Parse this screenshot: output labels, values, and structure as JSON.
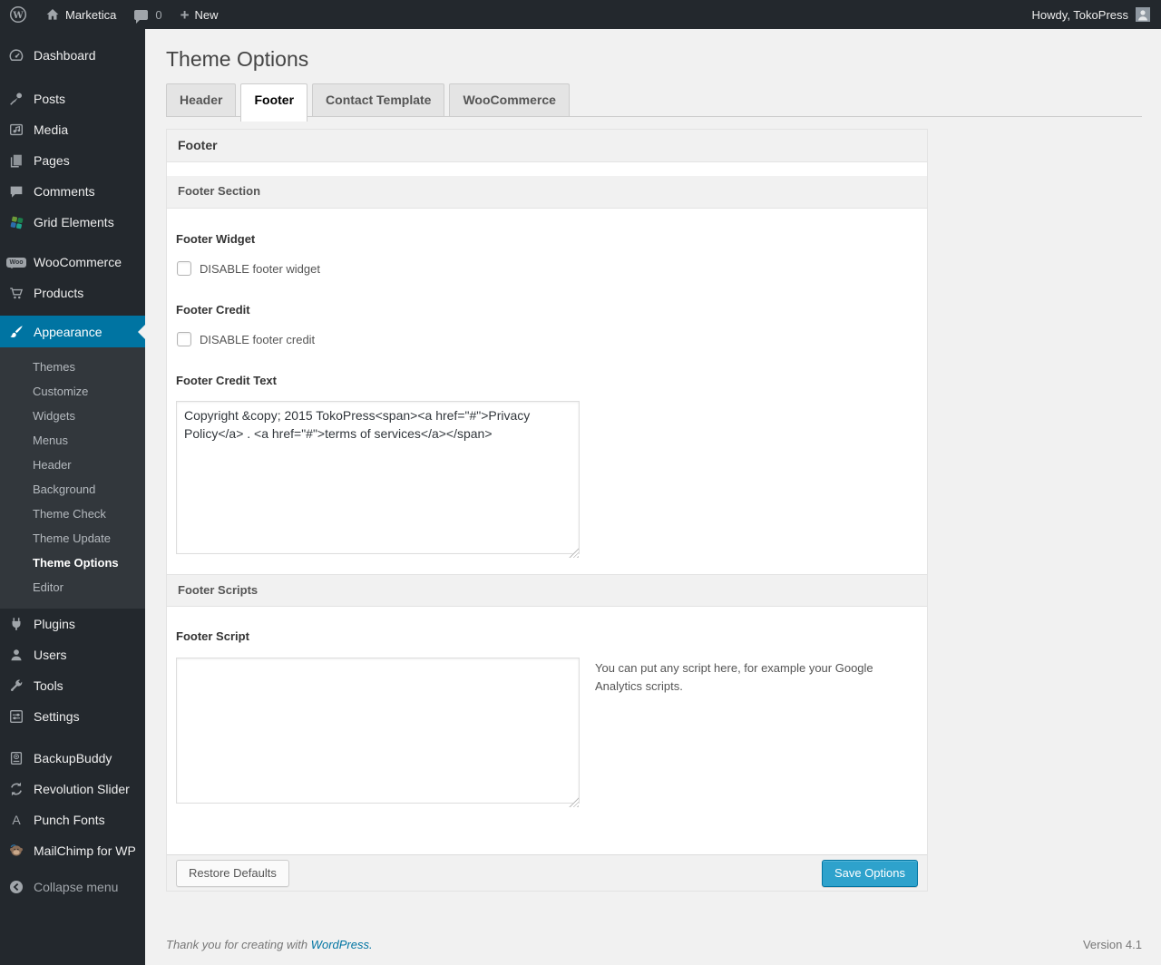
{
  "colors": {
    "accent": "#0074a2",
    "primary_button": "#2ea2cc",
    "admin_dark": "#23282d"
  },
  "admin_bar": {
    "site_name": "Marketica",
    "comments_count": "0",
    "new_label": "New",
    "howdy": "Howdy, TokoPress"
  },
  "sidebar": {
    "dashboard": "Dashboard",
    "posts": "Posts",
    "media": "Media",
    "pages": "Pages",
    "comments": "Comments",
    "grid_elements": "Grid Elements",
    "woocommerce": "WooCommerce",
    "woo_badge": "Woo",
    "products": "Products",
    "appearance": "Appearance",
    "appearance_submenu": [
      "Themes",
      "Customize",
      "Widgets",
      "Menus",
      "Header",
      "Background",
      "Theme Check",
      "Theme Update",
      "Theme Options",
      "Editor"
    ],
    "plugins": "Plugins",
    "users": "Users",
    "tools": "Tools",
    "settings": "Settings",
    "backupbuddy": "BackupBuddy",
    "revolution_slider": "Revolution Slider",
    "punch_fonts": "Punch Fonts",
    "punch_fonts_icon_letter": "A",
    "mailchimp": "MailChimp for WP",
    "collapse": "Collapse menu"
  },
  "main": {
    "title": "Theme Options",
    "tabs": [
      {
        "label": "Header"
      },
      {
        "label": "Footer"
      },
      {
        "label": "Contact Template"
      },
      {
        "label": "WooCommerce"
      }
    ],
    "active_tab": "Footer",
    "panel": {
      "box_title": "Footer",
      "section_title": "Footer Section",
      "footer_widget_label": "Footer Widget",
      "footer_widget_checkbox_label": "DISABLE footer widget",
      "footer_credit_label": "Footer Credit",
      "footer_credit_checkbox_label": "DISABLE footer credit",
      "footer_credit_text_label": "Footer Credit Text",
      "footer_credit_text_value": "Copyright &copy; 2015 TokoPress<span><a href=\"#\">Privacy Policy</a> . <a href=\"#\">terms of services</a></span>",
      "scripts_section_title": "Footer Scripts",
      "footer_script_label": "Footer Script",
      "footer_script_value": "",
      "footer_script_help": "You can put any script here, for example your Google Analytics scripts.",
      "restore_button": "Restore Defaults",
      "save_button": "Save Options"
    }
  },
  "page_footer": {
    "thanks_text": "Thank you for creating with",
    "wordpress_link": "WordPress.",
    "version": "Version 4.1"
  }
}
